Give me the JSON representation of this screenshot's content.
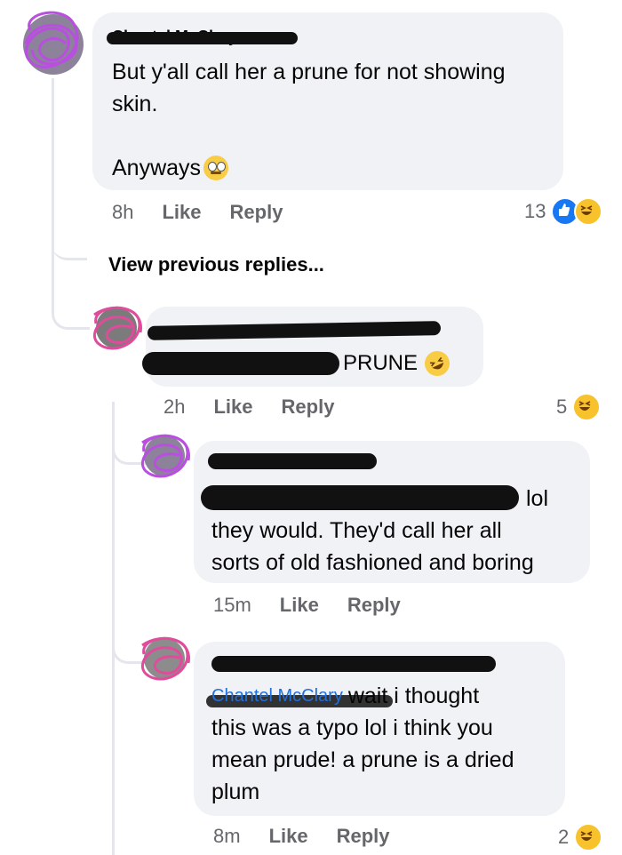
{
  "comments": [
    {
      "name": "Chantel McClary",
      "paragraphs": [
        "But y'all call her a prune for not showing skin.",
        "Anyways"
      ],
      "emoji": "eye-roll",
      "time": "8h",
      "like_label": "Like",
      "reply_label": "Reply",
      "reaction_count": "13",
      "reactions": [
        "like",
        "haha"
      ]
    }
  ],
  "view_previous": "View previous replies...",
  "replies": [
    {
      "name": "",
      "mention": "",
      "text": "PRUNE",
      "emoji": "rofl",
      "time": "2h",
      "like_label": "Like",
      "reply_label": "Reply",
      "reaction_count": "5",
      "reactions": [
        "haha"
      ]
    },
    {
      "name": "",
      "mention": "",
      "text_lines": [
        "lol",
        "they would. They'd call her all",
        "sorts of old fashioned and boring"
      ],
      "time": "15m",
      "like_label": "Like",
      "reply_label": "Reply"
    },
    {
      "name": "",
      "mention": "Chantel McClary",
      "text_lines": [
        "wait i thought",
        "this was a typo lol i think you",
        "mean prude! a prune is a dried",
        "plum"
      ],
      "time": "8m",
      "like_label": "Like",
      "reply_label": "Reply",
      "reaction_count": "2",
      "reactions": [
        "haha"
      ]
    }
  ]
}
